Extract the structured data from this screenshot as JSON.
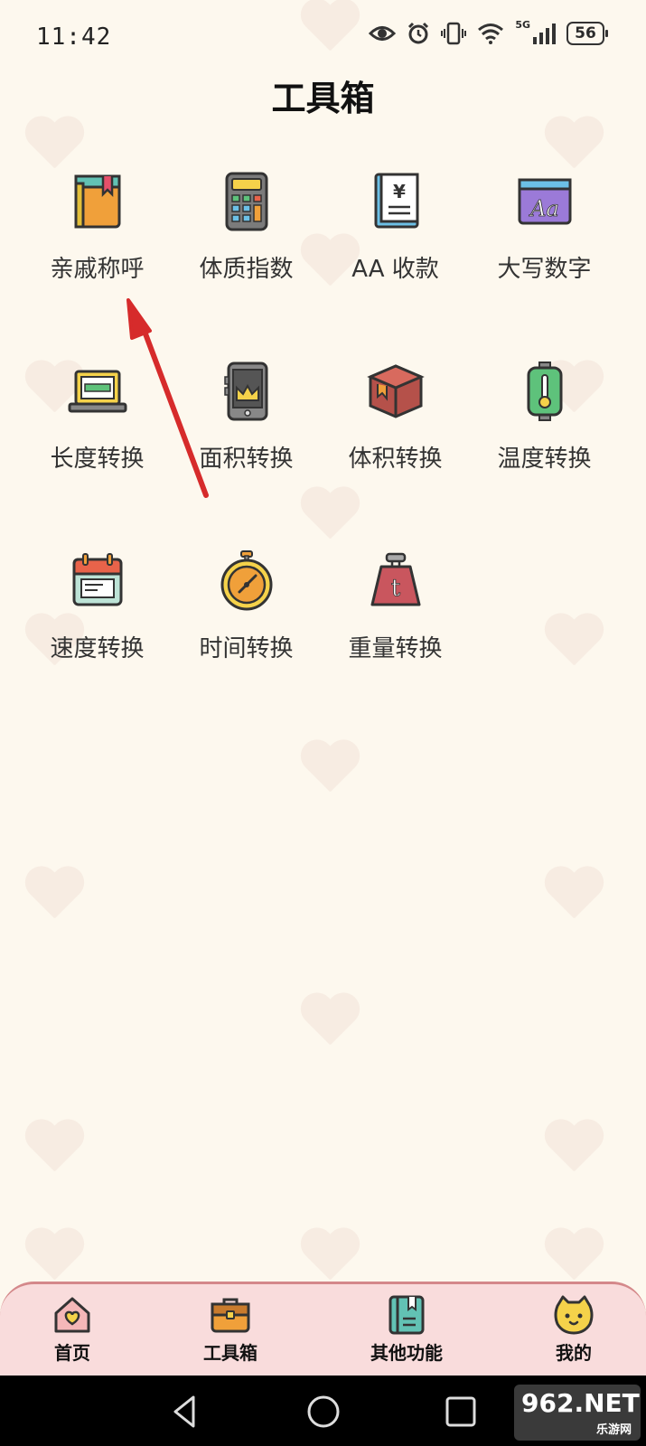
{
  "status_bar": {
    "time": "11:42",
    "network": "5G",
    "battery": "56"
  },
  "page": {
    "title": "工具箱"
  },
  "tools": [
    {
      "label": "亲戚称呼",
      "icon": "book-icon"
    },
    {
      "label": "体质指数",
      "icon": "calculator-icon"
    },
    {
      "label": "AA 收款",
      "icon": "yuan-book-icon"
    },
    {
      "label": "大写数字",
      "icon": "font-window-icon"
    },
    {
      "label": "长度转换",
      "icon": "laptop-ruler-icon"
    },
    {
      "label": "面积转换",
      "icon": "phone-crown-icon"
    },
    {
      "label": "体积转换",
      "icon": "box-icon"
    },
    {
      "label": "温度转换",
      "icon": "thermometer-icon"
    },
    {
      "label": "速度转换",
      "icon": "calendar-icon"
    },
    {
      "label": "时间转换",
      "icon": "stopwatch-icon"
    },
    {
      "label": "重量转换",
      "icon": "weight-icon"
    }
  ],
  "tabbar": {
    "items": [
      {
        "label": "首页",
        "icon": "home-heart-icon"
      },
      {
        "label": "工具箱",
        "icon": "toolbox-icon"
      },
      {
        "label": "其他功能",
        "icon": "notebook-icon"
      },
      {
        "label": "我的",
        "icon": "cat-face-icon"
      }
    ]
  },
  "watermark": {
    "main": "962.NET",
    "sub": "乐游网"
  },
  "colors": {
    "background": "#fdf8ee",
    "tabbar": "#f9dcdc",
    "accent": "#d4888a",
    "annotation_arrow": "#d62b2b"
  }
}
